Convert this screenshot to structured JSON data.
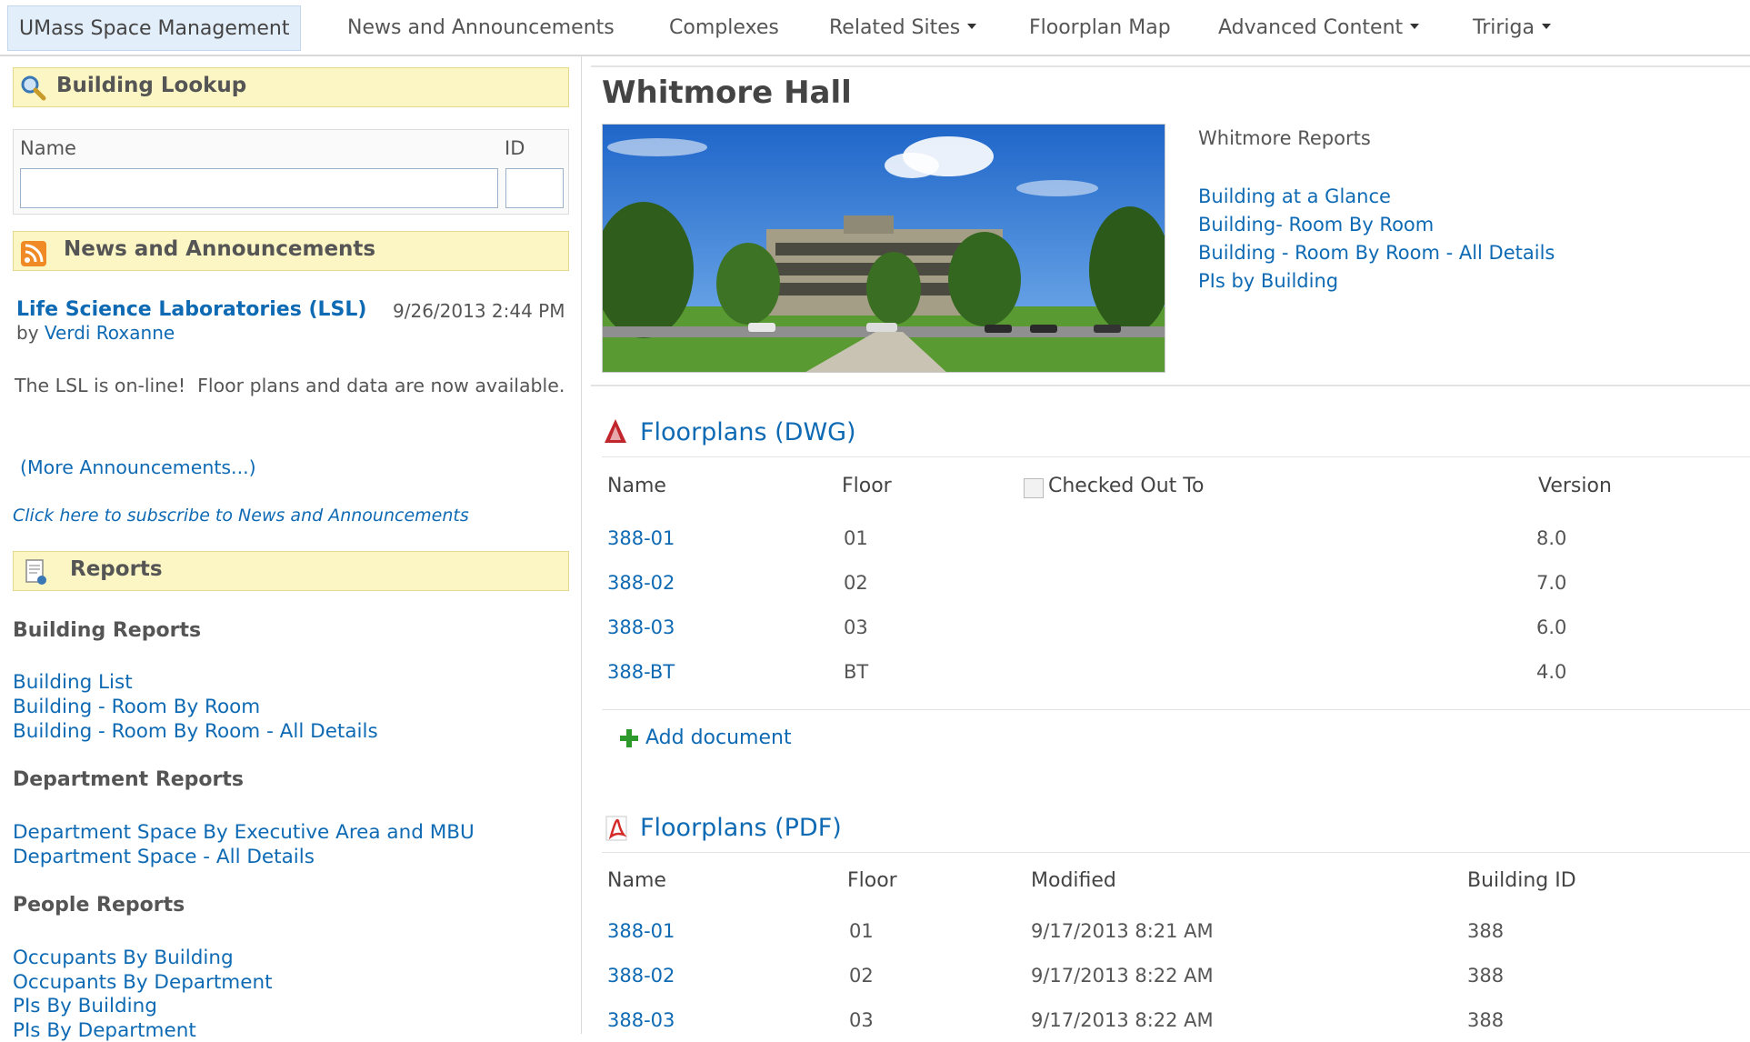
{
  "nav": {
    "items": [
      {
        "label": "UMass Space Management"
      },
      {
        "label": "News and Announcements"
      },
      {
        "label": "Complexes"
      },
      {
        "label": "Related Sites"
      },
      {
        "label": "Floorplan Map"
      },
      {
        "label": "Advanced Content"
      },
      {
        "label": "Tririga"
      }
    ]
  },
  "lookup": {
    "header": "Building Lookup",
    "name_label": "Name",
    "id_label": "ID",
    "name_value": "",
    "id_value": ""
  },
  "news": {
    "header": "News and Announcements",
    "item_title": "Life Science Laboratories (LSL)",
    "item_date": "9/26/2013 2:44 PM",
    "item_by": "by",
    "item_author": "Verdi Roxanne",
    "item_body": "The LSL is on-line!  Floor plans and data are now available.",
    "more": "(More Announcements...)",
    "subscribe": "Click here to subscribe to News and Announcements"
  },
  "reports": {
    "header": "Reports",
    "building_heading": "Building Reports",
    "building_links": [
      "Building List",
      "Building - Room By Room",
      "Building - Room By Room - All Details"
    ],
    "department_heading": "Department Reports",
    "department_links": [
      "Department Space By Executive Area and MBU",
      "Department Space - All Details"
    ],
    "people_heading": "People Reports",
    "people_links": [
      "Occupants By Building",
      "Occupants By Department",
      "PIs By Building",
      "PIs By Department"
    ]
  },
  "main": {
    "title": "Whitmore Hall",
    "side_heading": "Whitmore Reports",
    "side_links": [
      "Building at a Glance",
      "Building- Room By Room",
      "Building - Room By Room - All Details",
      "PIs by Building"
    ]
  },
  "dwg": {
    "title": "Floorplans (DWG)",
    "headers": [
      "Name",
      "Floor",
      "Checked Out To",
      "Version"
    ],
    "rows": [
      {
        "name": "388-01",
        "floor": "01",
        "checked": "",
        "version": "8.0"
      },
      {
        "name": "388-02",
        "floor": "02",
        "checked": "",
        "version": "7.0"
      },
      {
        "name": "388-03",
        "floor": "03",
        "checked": "",
        "version": "6.0"
      },
      {
        "name": "388-BT",
        "floor": "BT",
        "checked": "",
        "version": "4.0"
      }
    ],
    "add_label": "Add document"
  },
  "pdf": {
    "title": "Floorplans (PDF)",
    "headers": [
      "Name",
      "Floor",
      "Modified",
      "Building ID"
    ],
    "rows": [
      {
        "name": "388-01",
        "floor": "01",
        "modified": "9/17/2013 8:21 AM",
        "building_id": "388"
      },
      {
        "name": "388-02",
        "floor": "02",
        "modified": "9/17/2013 8:22 AM",
        "building_id": "388"
      },
      {
        "name": "388-03",
        "floor": "03",
        "modified": "9/17/2013 8:22 AM",
        "building_id": "388"
      }
    ]
  },
  "icons": {
    "lookup": "magnifier-icon",
    "news": "rss-icon",
    "reports": "report-icon",
    "dwg": "autocad-icon",
    "pdf": "pdf-icon",
    "add": "plus-icon",
    "caret": "caret-down-icon"
  },
  "colors": {
    "link": "#0f6ab4",
    "header_bg": "#fbf6c3",
    "nav_selected_bg": "#e3eefb"
  }
}
